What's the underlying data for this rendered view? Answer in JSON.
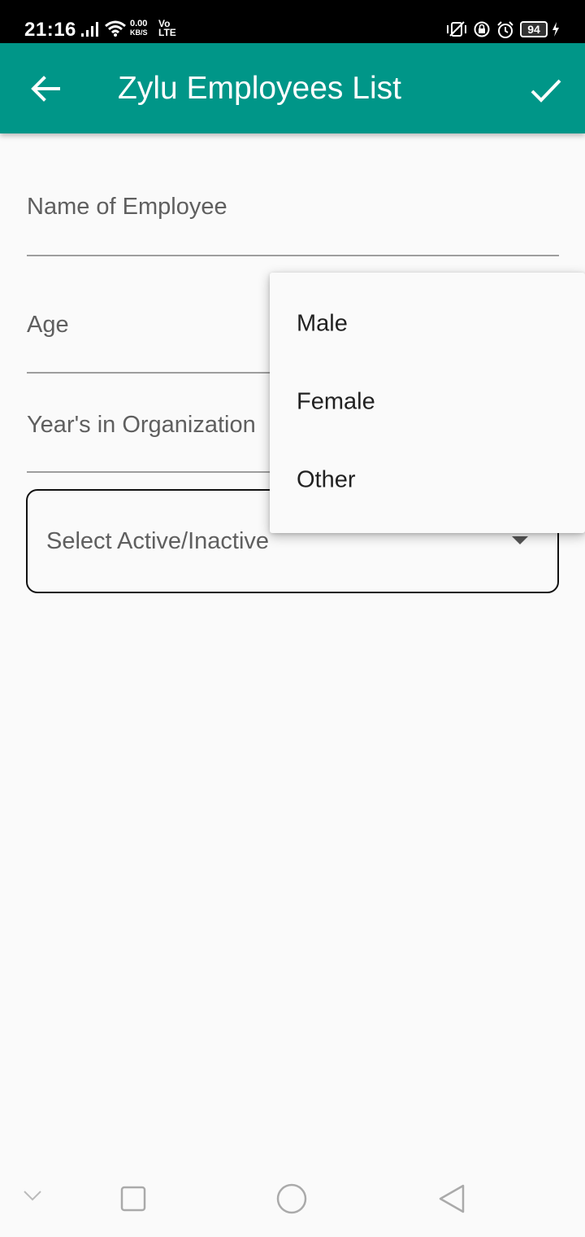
{
  "status_bar": {
    "time": "21:16",
    "net_speed": "0.00",
    "net_speed_unit": "KB/S",
    "volte_top": "Vo",
    "volte_bottom": "LTE",
    "battery": "94"
  },
  "app_bar": {
    "title": "Zylu Employees List",
    "back_icon": "arrow-left-icon",
    "confirm_icon": "check-icon",
    "color": "#009688"
  },
  "form": {
    "name_placeholder": "Name of Employee",
    "age_placeholder": "Age",
    "years_placeholder": "Year's in Organization",
    "status_select_placeholder": "Select Active/Inactive"
  },
  "gender_dropdown": {
    "options": [
      "Male",
      "Female",
      "Other"
    ]
  },
  "nav_bar": {
    "icons": [
      "chevron-down-icon",
      "square-recent-icon",
      "circle-home-icon",
      "triangle-back-icon"
    ]
  }
}
